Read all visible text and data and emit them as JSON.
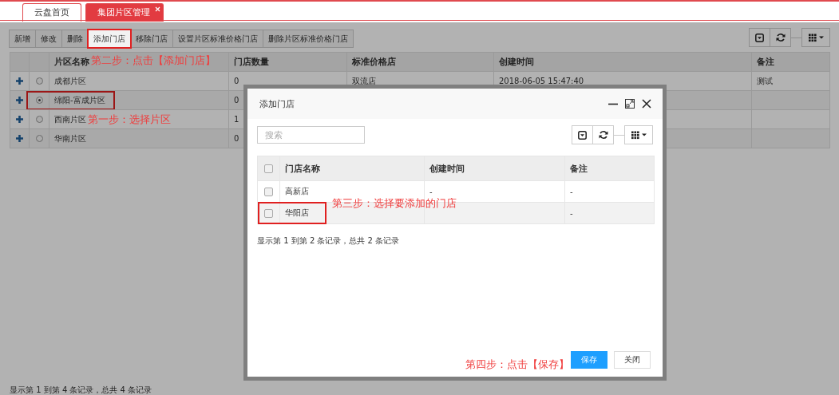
{
  "tabs": [
    {
      "label": "云盘首页",
      "selected": false,
      "closable": false
    },
    {
      "label": "集团片区管理",
      "selected": true,
      "closable": true
    }
  ],
  "toolbar": {
    "buttons": [
      {
        "label": "新增",
        "highlighted": false
      },
      {
        "label": "修改",
        "highlighted": false
      },
      {
        "label": "删除",
        "highlighted": false
      },
      {
        "label": "添加门店",
        "highlighted": true
      },
      {
        "label": "移除门店",
        "highlighted": false
      },
      {
        "label": "设置片区标准价格门店",
        "highlighted": false
      },
      {
        "label": "删除片区标准价格门店",
        "highlighted": false
      }
    ]
  },
  "table": {
    "columns": [
      "片区名称",
      "门店数量",
      "标准价格店",
      "创建时间",
      "备注"
    ],
    "rows": [
      {
        "selected": false,
        "highlighted": false,
        "cells": {
          "name": "成都片区",
          "count": "0",
          "standard_store": "双流店",
          "created": "2018-06-05 15:47:40",
          "note": "测试"
        }
      },
      {
        "selected": true,
        "highlighted": true,
        "cells": {
          "name": "绵阳-富成片区",
          "count": "0"
        }
      },
      {
        "selected": false,
        "highlighted": false,
        "cells": {
          "name": "西南片区",
          "count": "1"
        }
      },
      {
        "selected": false,
        "highlighted": false,
        "cells": {
          "name": "华南片区",
          "count": "0"
        }
      }
    ],
    "pagination": "显示第 1 到第 4 条记录，总共 4 条记录"
  },
  "annotations": [
    "第二步：点击【添加门店】",
    "第一步：选择片区",
    "第三步：选择要添加的门店",
    "第四步：点击【保存】"
  ],
  "dialog": {
    "title": "添加门店",
    "search": {
      "placeholder": "搜索"
    },
    "table": {
      "header_checked": false,
      "columns": [
        "门店名称",
        "创建时间",
        "备注"
      ],
      "rows": [
        {
          "checked": false,
          "highlighted": false,
          "cells": {
            "name": "高新店",
            "created": "-",
            "note": "-"
          }
        },
        {
          "checked": false,
          "highlighted": true,
          "cells": {
            "name": "华阳店",
            "note": "-"
          }
        }
      ],
      "pagination": "显示第 1 到第 2 条记录，总共 2 条记录"
    },
    "buttons": [
      {
        "label": "保存",
        "kind": "primary"
      },
      {
        "label": "关闭",
        "kind": "default"
      }
    ]
  }
}
